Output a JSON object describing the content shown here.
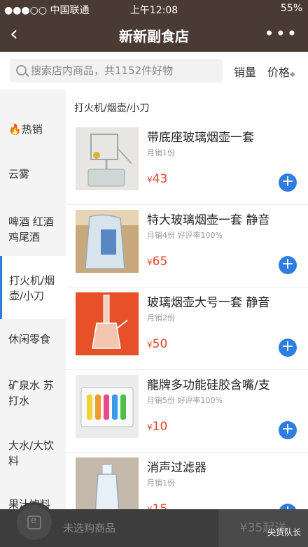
{
  "status": {
    "carrier": "●●●○○ 中国联通",
    "time": "上午12:08",
    "battery": "55%"
  },
  "header": {
    "back_label": "‹",
    "title": "新新副食店",
    "more_label": "•••"
  },
  "search": {
    "placeholder": "搜索店内商品，共1152件好物",
    "sort_sales": "销量",
    "sort_price": "价格",
    "sort_arrow": "◆"
  },
  "sidebar": {
    "items": [
      {
        "label": "热销",
        "icon": "🔥"
      },
      {
        "label": "云雾"
      },
      {
        "label": "啤酒 红酒鸡尾酒"
      },
      {
        "label": "打火机/烟壶/小刀"
      },
      {
        "label": "休闲零食"
      },
      {
        "label": "矿泉水 苏打水"
      },
      {
        "label": "大水/大饮料"
      },
      {
        "label": "果汁饮料"
      }
    ]
  },
  "section": {
    "title": "打火机/烟壶/小刀"
  },
  "products": [
    {
      "name": "带底座玻璃烟壶一套",
      "sales": "月销1份",
      "price": "43",
      "currency": "¥"
    },
    {
      "name": "特大玻璃烟壶一套 静音",
      "sales": "月销4份 好评率100%",
      "price": "65",
      "currency": "¥"
    },
    {
      "name": "玻璃烟壶大号一套 静音",
      "sales": "月销2份",
      "price": "50",
      "currency": "¥"
    },
    {
      "name": "龍牌多功能硅胶含嘴/支",
      "sales": "月销5份 好评率100%",
      "price": "10",
      "currency": "¥"
    },
    {
      "name": "消声过滤器",
      "sales": "月销1份",
      "price": "15",
      "currency": "¥"
    }
  ],
  "cart": {
    "empty_text": "未选购商品",
    "checkout": "¥35起送"
  },
  "watermark": "尖货队长",
  "colors": {
    "header": "#4a3a34",
    "accent": "#2f7de1",
    "price": "#e8452c"
  }
}
